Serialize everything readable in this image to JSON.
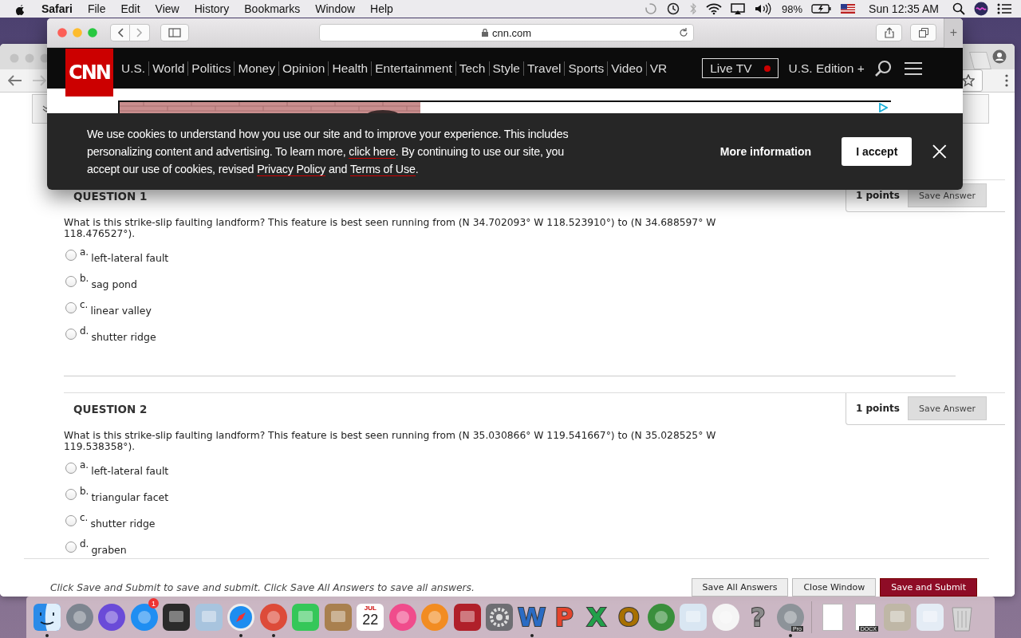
{
  "menu_bar": {
    "app": "Safari",
    "menus": [
      "File",
      "Edit",
      "View",
      "History",
      "Bookmarks",
      "Window",
      "Help"
    ],
    "battery": "98%",
    "clock": "Sun 12:35 AM"
  },
  "back_window": {
    "quiz": {
      "questions": [
        {
          "title": "QUESTION 1",
          "points": "1 points",
          "save": "Save Answer",
          "text": "What is this strike-slip faulting landform? This feature is best seen running from (N 34.702093° W 118.523910°) to (N 34.688597° W 118.476527°).",
          "options": [
            {
              "letter": "a.",
              "label": "left-lateral fault",
              "selected": false
            },
            {
              "letter": "b.",
              "label": "sag pond",
              "selected": false
            },
            {
              "letter": "c.",
              "label": "linear valley",
              "selected": false
            },
            {
              "letter": "d.",
              "label": "shutter ridge",
              "selected": false
            }
          ]
        },
        {
          "title": "QUESTION 2",
          "points": "1 points",
          "save": "Save Answer",
          "text": "What is this strike-slip faulting landform? This feature is best seen running from (N 35.030866° W 119.541667°) to (N 35.028525° W 119.538358°).",
          "options": [
            {
              "letter": "a.",
              "label": "left-lateral fault",
              "selected": false
            },
            {
              "letter": "b.",
              "label": "triangular facet",
              "selected": false
            },
            {
              "letter": "c.",
              "label": "shutter ridge",
              "selected": false
            },
            {
              "letter": "d.",
              "label": "graben",
              "selected": false
            }
          ]
        }
      ],
      "footer": {
        "hint": "Click Save and Submit to save and submit. Click Save All Answers to save all answers.",
        "buttons": [
          {
            "label": "Save All Answers",
            "kind": "plain"
          },
          {
            "label": "Close Window",
            "kind": "plain"
          },
          {
            "label": "Save and Submit",
            "kind": "primary"
          }
        ]
      }
    }
  },
  "safari": {
    "address": "cnn.com",
    "new_tab": "+",
    "cnn": {
      "logo": "CNN",
      "nav": [
        "U.S.",
        "World",
        "Politics",
        "Money",
        "Opinion",
        "Health",
        "Entertainment",
        "Tech",
        "Style",
        "Travel",
        "Sports",
        "Video",
        "VR"
      ],
      "live_tv": "Live TV",
      "edition": "U.S. Edition +",
      "cookie_banner": {
        "message": [
          {
            "kind": "text",
            "text": "We use cookies to understand how you use our site and to improve your experience. This includes personalizing content and advertising. To learn more, "
          },
          {
            "kind": "link",
            "text": "click here"
          },
          {
            "kind": "text",
            "text": ". By continuing to use our site, you accept our use of cookies, revised "
          },
          {
            "kind": "link",
            "text": "Privacy Policy"
          },
          {
            "kind": "text",
            "text": " and "
          },
          {
            "kind": "link",
            "text": "Terms of Use"
          },
          {
            "kind": "text",
            "text": "."
          }
        ],
        "more": "More information",
        "accept": "I accept"
      }
    }
  },
  "dock": {
    "items": [
      {
        "kind": "face",
        "color": "#2a8be8",
        "running": true
      },
      {
        "kind": "circle",
        "color": "#7d8590",
        "running": false
      },
      {
        "kind": "circle",
        "color": "#6a4bd8",
        "running": false
      },
      {
        "kind": "circle",
        "color": "#1f8ef2",
        "running": false,
        "badge": "1"
      },
      {
        "kind": "square",
        "color": "#2b2b2b",
        "running": false
      },
      {
        "kind": "square",
        "color": "#a8c4de",
        "running": false
      },
      {
        "kind": "compass",
        "color": "#1d8df0",
        "running": true
      },
      {
        "kind": "circle",
        "color": "#dd4b39",
        "running": true
      },
      {
        "kind": "square",
        "color": "#35c759",
        "running": false
      },
      {
        "kind": "square",
        "color": "#a9804f",
        "running": false
      },
      {
        "kind": "calendar",
        "color": "#ffffff",
        "running": false,
        "month": "JUL",
        "day": "22"
      },
      {
        "kind": "circle",
        "color": "#f04c8c",
        "running": false
      },
      {
        "kind": "circle",
        "color": "#f28c22",
        "running": false
      },
      {
        "kind": "square",
        "color": "#b0202a",
        "running": false
      },
      {
        "kind": "gear",
        "color": "#6e6e73",
        "running": false
      },
      {
        "kind": "letter",
        "color": "#2b6cc4",
        "running": true,
        "letter": "W"
      },
      {
        "kind": "letter",
        "color": "#e4442c",
        "running": false,
        "letter": "P"
      },
      {
        "kind": "letter",
        "color": "#21a04a",
        "running": false,
        "letter": "X"
      },
      {
        "kind": "letter",
        "color": "#a87000",
        "running": false,
        "letter": "O"
      },
      {
        "kind": "circle",
        "color": "#3a8f3c",
        "running": false
      },
      {
        "kind": "square",
        "color": "#d9e6f2",
        "running": false
      },
      {
        "kind": "circle",
        "color": "#f5f5f5",
        "running": false
      },
      {
        "kind": "letter",
        "color": "#8a8a8a",
        "running": false,
        "letter": "?"
      },
      {
        "kind": "circle",
        "color": "#8d9399",
        "running": true,
        "tag": "Pro"
      },
      {
        "kind": "separator"
      },
      {
        "kind": "doc",
        "color": "#ffffff",
        "running": false
      },
      {
        "kind": "doc",
        "color": "#ffffff",
        "running": false,
        "tag": "DOCX"
      },
      {
        "kind": "square",
        "color": "#bfb7a6",
        "running": false
      },
      {
        "kind": "square",
        "color": "#e4ecf5",
        "running": false
      },
      {
        "kind": "trash",
        "color": "#d6d6d6",
        "running": false
      }
    ]
  }
}
